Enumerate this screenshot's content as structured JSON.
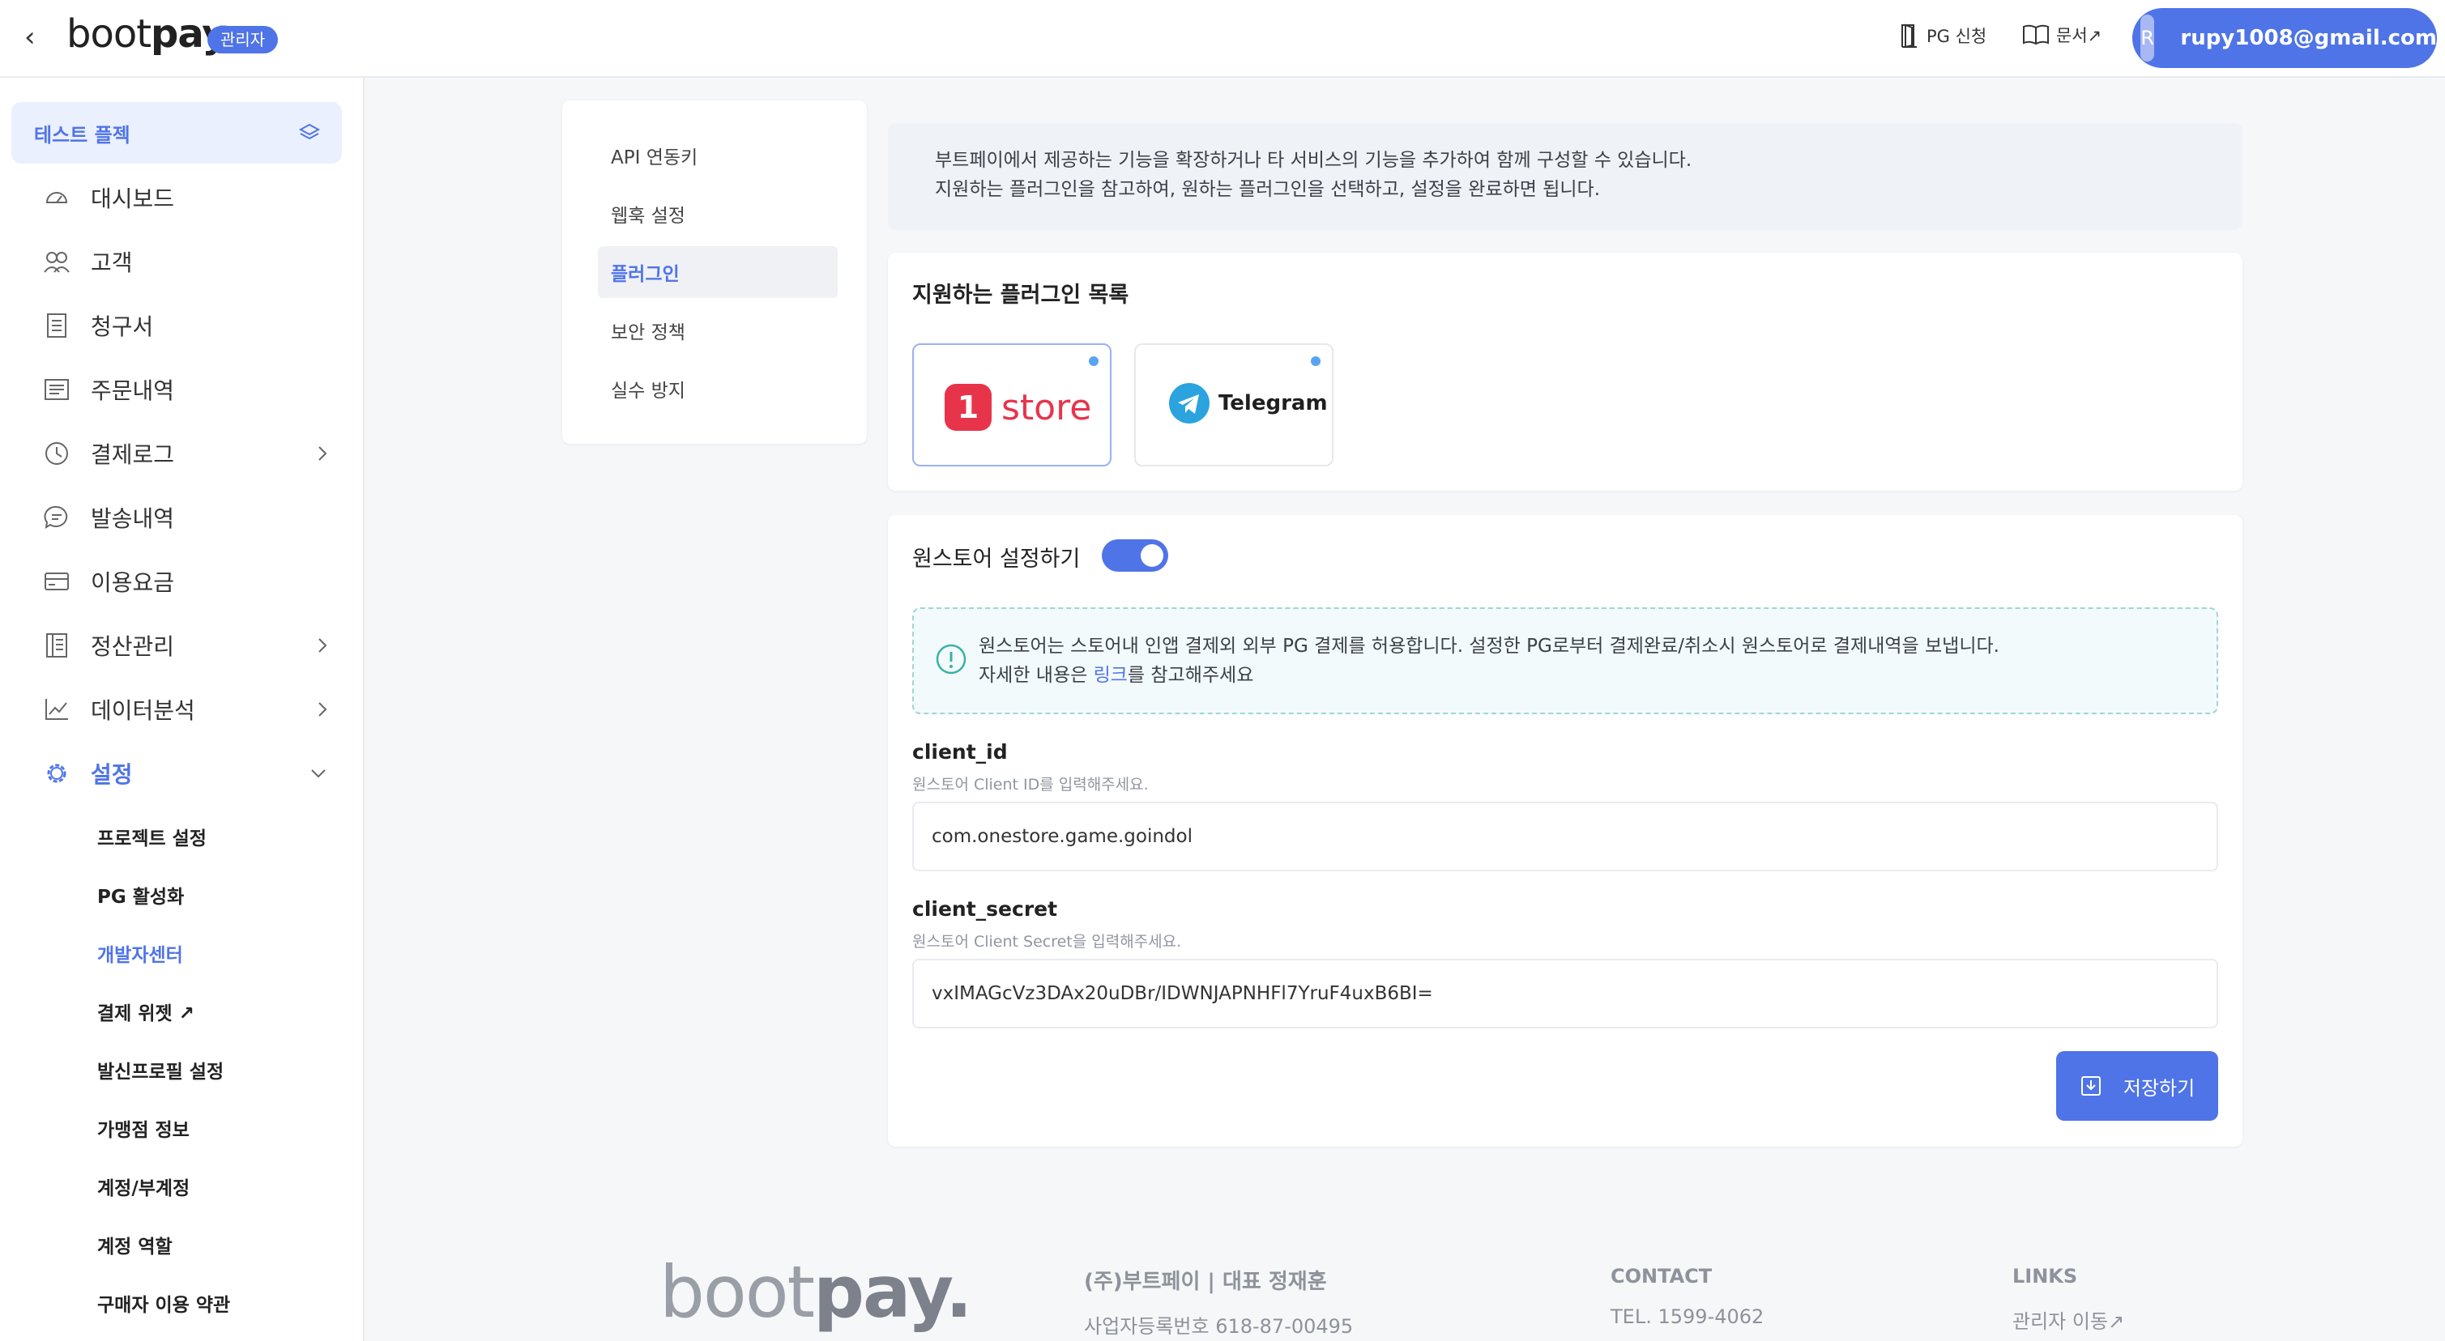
{
  "header": {
    "back_symbol": "‹",
    "logo_light": "boot",
    "logo_bold": "pay.",
    "admin_badge": "관리자",
    "pg_apply": "PG 신청",
    "docs": "문서↗",
    "user_initial": "R",
    "user_email": "rupy1008@gmail.com"
  },
  "sidebar": {
    "project": "테스트 플젝",
    "items": [
      {
        "label": "대시보드",
        "icon": "dashboard-icon"
      },
      {
        "label": "고객",
        "icon": "users-icon"
      },
      {
        "label": "청구서",
        "icon": "invoice-icon"
      },
      {
        "label": "주문내역",
        "icon": "orders-icon"
      },
      {
        "label": "결제로그",
        "icon": "clock-icon"
      },
      {
        "label": "발송내역",
        "icon": "message-icon"
      },
      {
        "label": "이용요금",
        "icon": "card-icon"
      },
      {
        "label": "정산관리",
        "icon": "ledger-icon"
      },
      {
        "label": "데이터분석",
        "icon": "chart-icon"
      },
      {
        "label": "설정",
        "icon": "gear-icon"
      }
    ],
    "sub_items": [
      "프로젝트 설정",
      "PG 활성화",
      "개발자센터",
      "결제 위젯 ↗",
      "발신프로필 설정",
      "가맹점 정보",
      "계정/부계정",
      "계정 역할",
      "구매자 이용 약관"
    ]
  },
  "subnav": {
    "items": [
      "API 연동키",
      "웹훅 설정",
      "플러그인",
      "보안 정책",
      "실수 방지"
    ]
  },
  "intro": {
    "line1": "부트페이에서 제공하는 기능을 확장하거나 타 서비스의 기능을 추가하여 함께 구성할 수 있습니다.",
    "line2": "지원하는 플러그인을 참고하여, 원하는 플러그인을 선택하고, 설정을 완료하면 됩니다."
  },
  "plugins": {
    "title": "지원하는 플러그인 목록",
    "onestore_digit": "1",
    "onestore_word": "store",
    "telegram_word": "Telegram"
  },
  "onestore": {
    "title": "원스토어 설정하기",
    "enabled": true,
    "notice_line1": "원스토어는 스토어내 인앱 결제외 외부 PG 결제를 허용합니다. 설정한 PG로부터 결제완료/취소시 원스토어로 결제내역을 보냅니다.",
    "notice_line2_pre": "자세한 내용은 ",
    "notice_link": "링크",
    "notice_line2_post": "를 참고해주세요",
    "client_id_label": "client_id",
    "client_id_help": "원스토어 Client ID를 입력해주세요.",
    "client_id_value": "com.onestore.game.goindol",
    "client_secret_label": "client_secret",
    "client_secret_help": "원스토어 Client Secret을 입력해주세요.",
    "client_secret_value": "vxIMAGcVz3DAx20uDBr/IDWNJAPNHFl7YruF4uxB6BI=",
    "save_label": "저장하기"
  },
  "footer": {
    "logo_light": "boot",
    "logo_bold": "pay.",
    "company": "(주)부트페이 | 대표 정재훈",
    "reg": "사업자등록번호 618-87-00495",
    "contact_h": "CONTACT",
    "tel": "TEL. 1599-4062",
    "links_h": "LINKS",
    "admin_move": "관리자 이동↗"
  },
  "colors": {
    "accent": "#4f74e8",
    "onestore_red": "#e8344b",
    "telegram_blue": "#2aa3df"
  }
}
